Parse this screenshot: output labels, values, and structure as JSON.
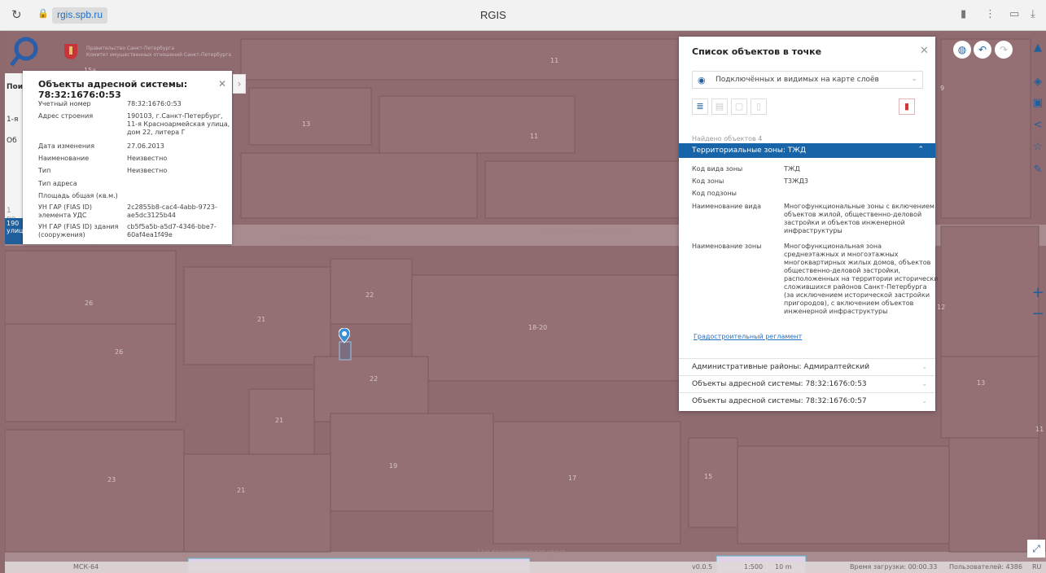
{
  "browser": {
    "url": "rgis.spb.ru",
    "title": "RGIS"
  },
  "header": {
    "gov_line1": "Правительство Санкт-Петербурга",
    "gov_line2": "Комитет имущественных отношений Санкт-Петербурга"
  },
  "left_sliver": {
    "items": [
      "Пои",
      "1-я",
      "Об",
      "1 ре"
    ],
    "blue_text": "190 улиц"
  },
  "popup": {
    "title": "Объекты адресной системы: 78:32:1676:0:53",
    "rows": [
      {
        "k": "Учетный номер",
        "v": "78:32:1676:0:53"
      },
      {
        "k": "Адрес строения",
        "v": "190103, г.Санкт-Петербург, 11-я Красноармейская улица, дом 22, литера Г"
      },
      {
        "k": "Дата изменения",
        "v": "27.06.2013"
      },
      {
        "k": "Наименование",
        "v": "Неизвестно"
      },
      {
        "k": "Тип",
        "v": "Неизвестно"
      },
      {
        "k": "Тип адреса",
        "v": ""
      },
      {
        "k": "Площадь общая (кв.м.)",
        "v": ""
      },
      {
        "k": "УН ГАР (FIAS ID) элемента УДС",
        "v": "2c2855b8-cac4-4abb-9723-ae5dc3125b44"
      },
      {
        "k": "УН ГАР (FIAS ID) здания (сооружения)",
        "v": "cb5f5a5b-a5d7-4346-bbe7-60af4ea1f49e"
      }
    ]
  },
  "panel": {
    "title": "Список объектов в точке",
    "select_value": "Подключённых и видимых на карте слоёв",
    "found": "Найдено объектов 4",
    "section_title": "Территориальные зоны: ТЖД",
    "zone_rows": [
      {
        "k": "Код вида зоны",
        "v": "ТЖД"
      },
      {
        "k": "Код зоны",
        "v": "Т3ЖД3"
      },
      {
        "k": "Код подзоны",
        "v": ""
      },
      {
        "k": "Наименование вида",
        "v": "Многофункциональные зоны с включением объектов жилой, общественно-деловой застройки и объектов инженерной инфраструктуры"
      },
      {
        "k": "Наименование зоны",
        "v": "Многофункциональная зона среднеэтажных и многоэтажных многоквартирных жилых домов, объектов общественно-деловой застройки, расположенных на территории исторически сложившихся районов Санкт-Петербурга (за исключением исторической застройки пригородов), с включением объектов инженерной инфраструктуры"
      }
    ],
    "reg_link": "Градостроительный регламент",
    "collapsed": [
      "Административные районы: Адмиралтейский",
      "Объекты адресной системы: 78:32:1676:0:53",
      "Объекты адресной системы: 78:32:1676:0:57"
    ]
  },
  "map": {
    "labels": [
      "11",
      "13",
      "11",
      "26",
      "21",
      "22",
      "26",
      "22",
      "18-20",
      "21",
      "19",
      "23",
      "21",
      "17",
      "15",
      "13",
      "11",
      "12",
      "9",
      "15a"
    ],
    "streets": [
      "11-я Красноармейская улица",
      "11-я Красноармейская улица",
      "11-я Красноармейская улица",
      "11-я Красноармейская улица"
    ]
  },
  "bottom": {
    "crs": "МСК-64",
    "version": "v0.0.5",
    "scale": "1:500",
    "scale_bar": "10 m",
    "load_time": "Время загрузки: 00:00.33",
    "users": "Пользователей: 4386",
    "lang": "RU"
  }
}
